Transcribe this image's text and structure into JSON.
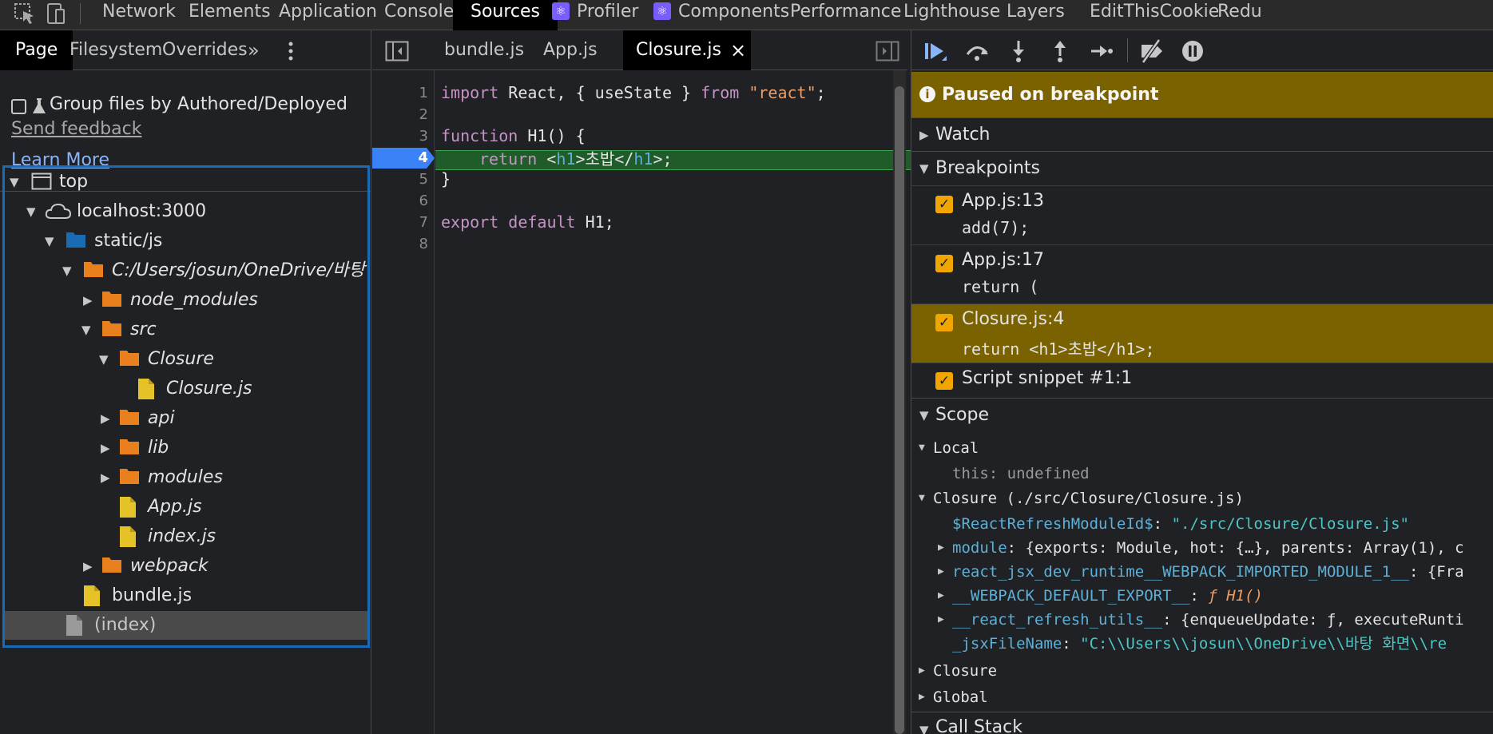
{
  "toolbar": {
    "tabs": [
      "Network",
      "Elements",
      "Application",
      "Console",
      "Sources",
      "Profiler",
      "Components",
      "Performance",
      "Lighthouse",
      "Layers",
      "EditThisCookie",
      "Redu"
    ],
    "active_tab": "Sources"
  },
  "navigator": {
    "tabs": [
      "Page",
      "Filesystem",
      "Overrides"
    ],
    "more": "»",
    "group_files_label": "Group files by Authored/Deployed",
    "send_feedback": "Send feedback",
    "learn_more": "Learn More",
    "tree": [
      {
        "label": "top",
        "icon": "frame-icon"
      },
      {
        "label": "localhost:3000",
        "icon": "cloud-icon"
      },
      {
        "label": "static/js",
        "icon": "folder-blue-icon"
      },
      {
        "label": "C:/Users/josun/OneDrive/바탕 화",
        "icon": "folder-icon"
      },
      {
        "label": "node_modules",
        "icon": "folder-icon"
      },
      {
        "label": "src",
        "icon": "folder-icon"
      },
      {
        "label": "Closure",
        "icon": "folder-icon"
      },
      {
        "label": "Closure.js",
        "icon": "file-js-icon"
      },
      {
        "label": "api",
        "icon": "folder-icon"
      },
      {
        "label": "lib",
        "icon": "folder-icon"
      },
      {
        "label": "modules",
        "icon": "folder-icon"
      },
      {
        "label": "App.js",
        "icon": "file-js-icon"
      },
      {
        "label": "index.js",
        "icon": "file-js-icon"
      },
      {
        "label": "webpack",
        "icon": "folder-icon"
      },
      {
        "label": "bundle.js",
        "icon": "file-js-icon"
      },
      {
        "label": "(index)",
        "icon": "file-icon"
      }
    ]
  },
  "editor": {
    "tabs": [
      "bundle.js",
      "App.js",
      "Closure.js"
    ],
    "active_tab": "Closure.js",
    "close_glyph": "×",
    "line_numbers": [
      "1",
      "2",
      "3",
      "4",
      "5",
      "6",
      "7",
      "8"
    ],
    "code": {
      "l1_import": "import",
      "l1_rest": " React, { useState } ",
      "l1_from": "from",
      "l1_str": " \"react\"",
      "l1_end": ";",
      "l3_function": "function",
      "l3_rest": " H1() {",
      "l4_return": "return",
      "l4_open": " <",
      "l4_tag1": "h1",
      "l4_mid": ">초밥</",
      "l4_tag2": "h1",
      "l4_end": ">;",
      "l5": "}",
      "l7_export": "export",
      "l7_default": " default",
      "l7_rest": " H1;"
    }
  },
  "debugger": {
    "paused_text": "Paused on breakpoint",
    "sections": {
      "watch": "Watch",
      "breakpoints": "Breakpoints",
      "scope": "Scope",
      "call_stack": "Call Stack"
    },
    "breakpoints": [
      {
        "location": "App.js:13",
        "code": "add(7);"
      },
      {
        "location": "App.js:17",
        "code": "return ("
      },
      {
        "location": "Closure.js:4",
        "code": "return <h1>초밥</h1>;"
      },
      {
        "location": "Script snippet #1:1",
        "code": ""
      }
    ],
    "scope": {
      "local": "Local",
      "this_key": "this",
      "this_val": "undefined",
      "closure_header": "Closure (./src/Closure/Closure.js)",
      "items": [
        {
          "key": "$ReactRefreshModuleId$",
          "value": "\"./src/Closure/Closure.js\""
        },
        {
          "key": "module",
          "value": "{exports: Module, hot: {…}, parents: Array(1), c"
        },
        {
          "key": "react_jsx_dev_runtime__WEBPACK_IMPORTED_MODULE_1__",
          "value": "{Fra"
        },
        {
          "key": "__WEBPACK_DEFAULT_EXPORT__",
          "value": "ƒ H1()"
        },
        {
          "key": "__react_refresh_utils__",
          "value": "{enqueueUpdate: ƒ, executeRunti"
        },
        {
          "key": "_jsxFileName",
          "value": "\"C:\\\\Users\\\\josun\\\\OneDrive\\\\바탕 화면\\\\re"
        }
      ],
      "closure2": "Closure",
      "global": "Global"
    }
  },
  "colors": {
    "accent_blue": "#1a6bb5",
    "paused_bg": "#7a6200",
    "folder_orange": "#e8801e",
    "file_yellow": "#e6c229"
  }
}
